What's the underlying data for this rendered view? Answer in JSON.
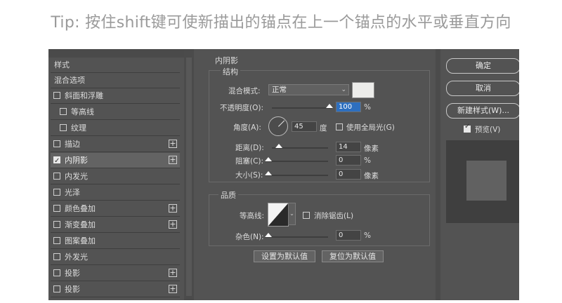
{
  "tip": "Tip: 按住shift键可使新描出的锚点在上一个锚点的水平或垂直方向",
  "style_list": {
    "items": [
      {
        "label": "样式",
        "checkbox": false,
        "checked": false,
        "plus": false,
        "indent": false,
        "active": false
      },
      {
        "label": "混合选项",
        "checkbox": false,
        "checked": false,
        "plus": false,
        "indent": false,
        "active": false
      },
      {
        "label": "斜面和浮雕",
        "checkbox": true,
        "checked": false,
        "plus": false,
        "indent": false,
        "active": false
      },
      {
        "label": "等高线",
        "checkbox": true,
        "checked": false,
        "plus": false,
        "indent": true,
        "active": false
      },
      {
        "label": "纹理",
        "checkbox": true,
        "checked": false,
        "plus": false,
        "indent": true,
        "active": false
      },
      {
        "label": "描边",
        "checkbox": true,
        "checked": false,
        "plus": true,
        "indent": false,
        "active": false
      },
      {
        "label": "内阴影",
        "checkbox": true,
        "checked": true,
        "plus": true,
        "indent": false,
        "active": true
      },
      {
        "label": "内发光",
        "checkbox": true,
        "checked": false,
        "plus": false,
        "indent": false,
        "active": false
      },
      {
        "label": "光泽",
        "checkbox": true,
        "checked": false,
        "plus": false,
        "indent": false,
        "active": false
      },
      {
        "label": "颜色叠加",
        "checkbox": true,
        "checked": false,
        "plus": true,
        "indent": false,
        "active": false
      },
      {
        "label": "渐变叠加",
        "checkbox": true,
        "checked": false,
        "plus": true,
        "indent": false,
        "active": false
      },
      {
        "label": "图案叠加",
        "checkbox": true,
        "checked": false,
        "plus": false,
        "indent": false,
        "active": false
      },
      {
        "label": "外发光",
        "checkbox": true,
        "checked": false,
        "plus": false,
        "indent": false,
        "active": false
      },
      {
        "label": "投影",
        "checkbox": true,
        "checked": false,
        "plus": true,
        "indent": false,
        "active": false
      },
      {
        "label": "投影",
        "checkbox": true,
        "checked": false,
        "plus": true,
        "indent": false,
        "active": false
      }
    ]
  },
  "panel": {
    "title": "内阴影",
    "structure_title": "结构",
    "blend_mode_label": "混合模式:",
    "blend_mode_value": "正常",
    "opacity_label": "不透明度(O):",
    "opacity_value": "100",
    "opacity_unit": "%",
    "angle_label": "角度(A):",
    "angle_value": "45",
    "angle_unit": "度",
    "global_light_label": "使用全局光(G)",
    "distance_label": "距离(D):",
    "distance_value": "14",
    "distance_unit": "像素",
    "choke_label": "阻塞(C):",
    "choke_value": "0",
    "choke_unit": "%",
    "size_label": "大小(S):",
    "size_value": "0",
    "size_unit": "像素",
    "quality_title": "品质",
    "contour_label": "等高线:",
    "antialias_label": "消除锯齿(L)",
    "noise_label": "杂色(N):",
    "noise_value": "0",
    "noise_unit": "%",
    "set_default_label": "设置为默认值",
    "reset_default_label": "复位为默认值"
  },
  "right": {
    "ok_label": "确定",
    "cancel_label": "取消",
    "new_style_label": "新建样式(W)...",
    "preview_label": "预览(V)",
    "preview_checked": true
  },
  "colors": {
    "dialog_bg": "#535353",
    "highlight": "#2d6fbf",
    "shadow_swatch": "#ececea"
  }
}
